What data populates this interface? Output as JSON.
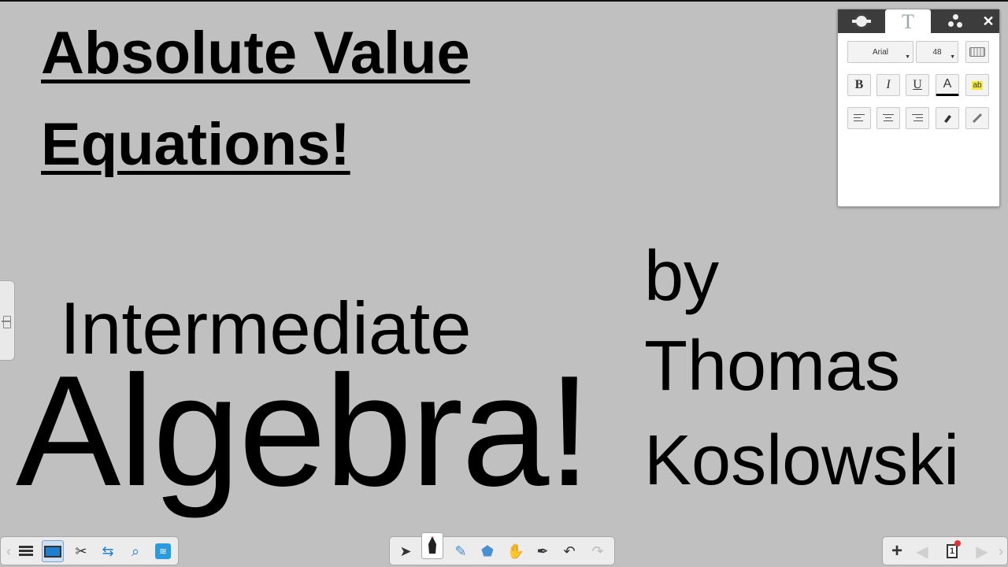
{
  "slide": {
    "title_line1": "Absolute Value",
    "title_line2": "Equations!",
    "subtitle": "Intermediate",
    "main_word": "Algebra!",
    "author_by": "by",
    "author_first": "Thomas",
    "author_last": "Koslowski"
  },
  "text_panel": {
    "font_name": "Arial",
    "font_size": "48",
    "bold_label": "B",
    "italic_label": "I",
    "underline_label": "U",
    "color_label": "A",
    "highlight_label": "ab",
    "active_tab": "text"
  },
  "toolbar": {
    "page_number": "1",
    "active_tool": "pen"
  },
  "colors": {
    "background": "#c0c0c0",
    "text": "#000000",
    "panel_header": "#3c3c3c",
    "accent_blue": "#1e7fd0"
  },
  "icons": [
    "gear-icon",
    "text-tool-icon",
    "effects-icon",
    "close-icon",
    "keyboard-icon",
    "align-left-icon",
    "align-center-icon",
    "align-right-icon",
    "eraser-icon",
    "link-icon",
    "menu-icon",
    "display-icon",
    "tools-icon",
    "screen-share-icon",
    "magnifier-icon",
    "wireless-icon",
    "select-arrow-icon",
    "pen-icon",
    "highlighter-icon",
    "shape-fill-icon",
    "hand-icon",
    "magic-pen-icon",
    "undo-icon",
    "redo-icon",
    "add-page-icon",
    "page-sorter-icon",
    "previous-page-icon",
    "next-page-icon"
  ]
}
